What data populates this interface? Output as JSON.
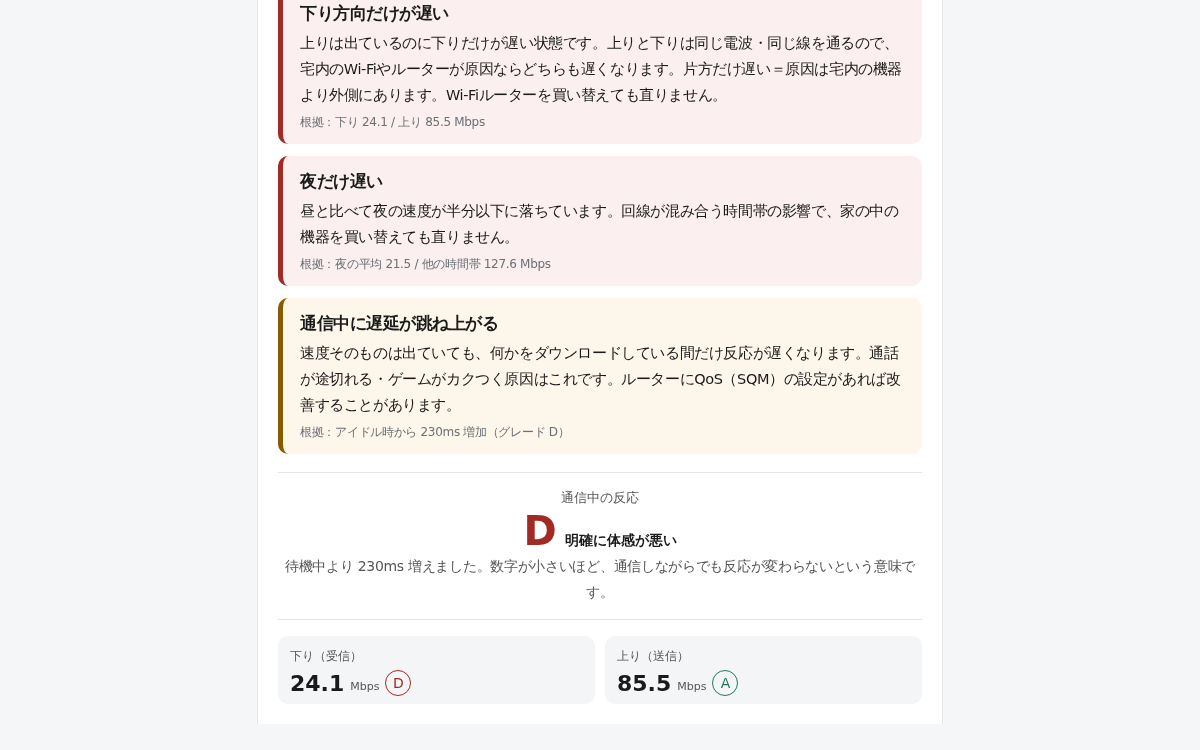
{
  "alerts": [
    {
      "title": "下り方向だけが遅い",
      "body": "上りは出ているのに下りだけが遅い状態です。上りと下りは同じ電波・同じ線を通るので、宅内のWi-Fiやルーターが原因ならどちらも遅くなります。片方だけ遅い＝原因は宅内の機器より外側にあります。Wi-Fiルーターを買い替えても直りません。",
      "evidence": "根拠：下り 24.1 / 上り 85.5 Mbps",
      "color": "#a32a24"
    },
    {
      "title": "夜だけ遅い",
      "body": "昼と比べて夜の速度が半分以下に落ちています。回線が混み合う時間帯の影響で、家の中の機器を買い替えても直りません。",
      "evidence": "根拠：夜の平均 21.5 / 他の時間帯 127.6 Mbps",
      "color": "#a32a24"
    },
    {
      "title": "通信中に遅延が跳ね上がる",
      "body": "速度そのものは出ていても、何かをダウンロードしている間だけ反応が遅くなります。通話が途切れる・ゲームがカクつく原因はこれです。ルーターにQoS（SQM）の設定があれば改善することがあります。",
      "evidence": "根拠：アイドル時から 230ms 増加（グレード D）",
      "color": "#8a5a00"
    }
  ],
  "responsiveness": {
    "label": "通信中の反応",
    "grade": "D",
    "color": "#a32a24",
    "verdict": "明確に体感が悪い",
    "description": "待機中より 230ms 増えました。数字が小さいほど、通信しながらでも反応が変わらないという意味です。"
  },
  "metrics": [
    {
      "label": "下り（受信）",
      "value": "24.1",
      "unit": "Mbps",
      "grade": "D",
      "color": "#a32a24"
    },
    {
      "label": "上り（送信）",
      "value": "85.5",
      "unit": "Mbps",
      "grade": "A",
      "color": "#1f7a5a"
    }
  ]
}
